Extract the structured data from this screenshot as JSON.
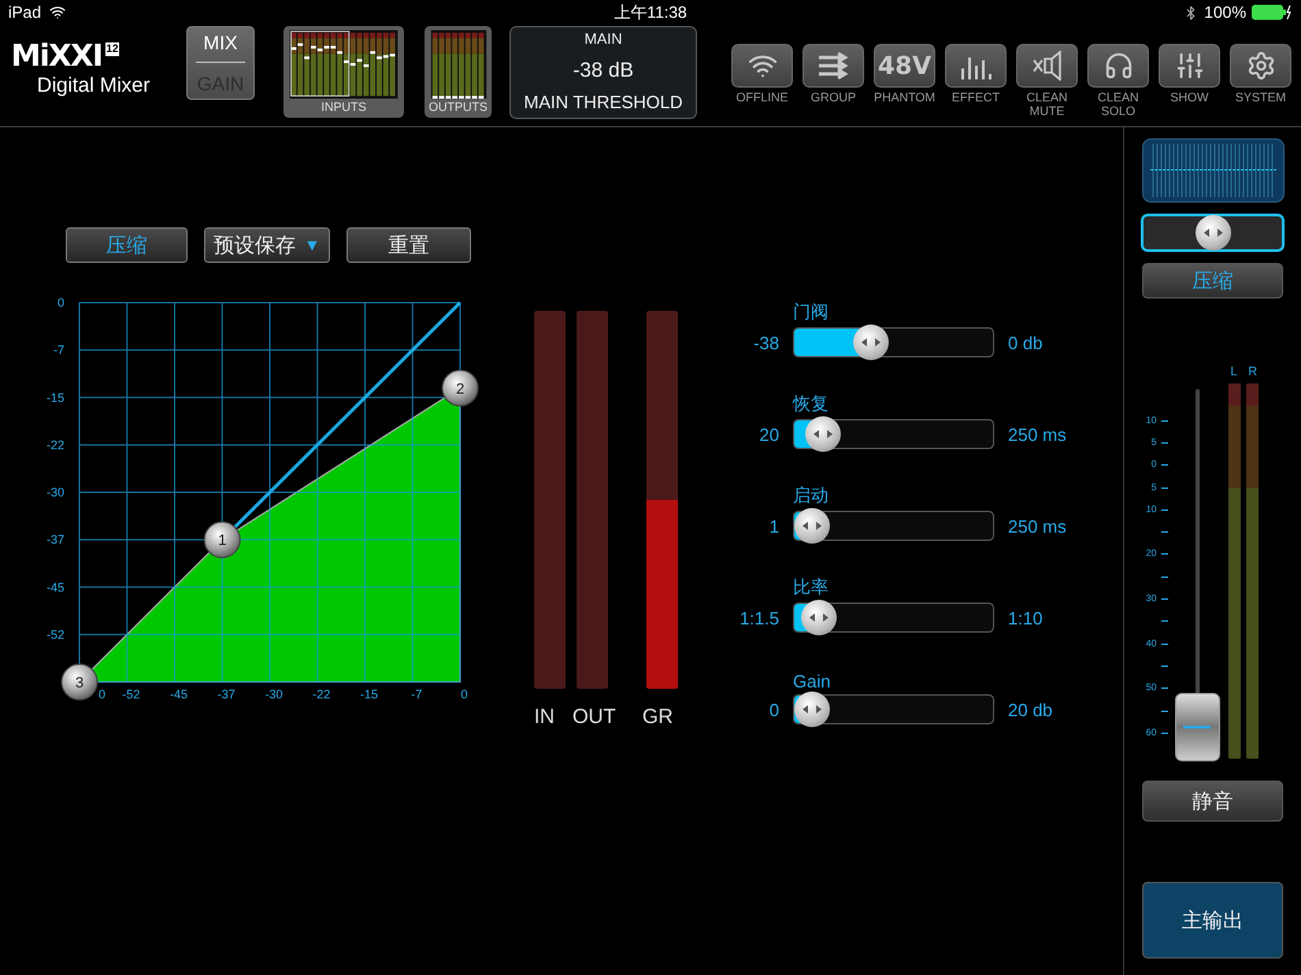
{
  "status_bar": {
    "device": "iPad",
    "time": "上午11:38",
    "battery": "100%"
  },
  "header": {
    "logo": {
      "mark": "MiXXI",
      "badge": "12",
      "subtitle": "Digital Mixer"
    },
    "view_toggle": [
      {
        "label": "MIX",
        "selected": true
      },
      {
        "label": "GAIN",
        "selected": false
      }
    ],
    "thumbnails": [
      {
        "kind": "inputs",
        "label": "INPUTS"
      },
      {
        "kind": "outputs",
        "label": "OUTPUTS"
      }
    ],
    "display": {
      "title": "MAIN",
      "value": "-38 dB",
      "caption": "MAIN THRESHOLD"
    },
    "tools": [
      {
        "kind": "wifi",
        "label": "OFFLINE"
      },
      {
        "kind": "group",
        "label": "GROUP"
      },
      {
        "kind": "phantom",
        "icon_text": "48V",
        "label": "PHANTOM"
      },
      {
        "kind": "effect",
        "label": "EFFECT"
      },
      {
        "kind": "mute",
        "label": "CLEAN MUTE"
      },
      {
        "kind": "solo",
        "label": "CLEAN SOLO"
      },
      {
        "kind": "show",
        "label": "SHOW"
      },
      {
        "kind": "system",
        "label": "SYSTEM"
      }
    ]
  },
  "editor": {
    "actions": [
      {
        "kind": "mode",
        "label": "压缩"
      },
      {
        "kind": "dropdown",
        "label": "预设保存",
        "caret": "▼"
      },
      {
        "kind": "button",
        "label": "重置"
      }
    ],
    "curve_editor": {
      "y_labels": [
        "0",
        "-7",
        "-15",
        "-22",
        "-30",
        "-37",
        "-45",
        "-52"
      ],
      "x_labels": [
        "0",
        "-52",
        "-45",
        "-37",
        "-30",
        "-22",
        "-15",
        "-7",
        "0"
      ],
      "handles": [
        "1",
        "2",
        "3"
      ]
    },
    "meters": [
      {
        "label": "IN",
        "level": 0
      },
      {
        "label": "OUT",
        "level": 0
      },
      {
        "label": "GR",
        "level": 0.5
      }
    ],
    "sliders": [
      {
        "label": "门阀",
        "value": "-38",
        "max": "0 db",
        "level": 0.36
      },
      {
        "label": "恢复",
        "value": "20",
        "max": "250 ms",
        "level": 0.07
      },
      {
        "label": "启动",
        "value": "1",
        "max": "250 ms",
        "level": 0
      },
      {
        "label": "比率",
        "value": "1:1.5",
        "max": "1:10",
        "level": 0.04
      },
      {
        "label": "Gain",
        "value": "0",
        "max": "20 db",
        "level": 0
      }
    ]
  },
  "channel_strip": {
    "mode": "压缩",
    "fader": {
      "scale": [
        "10",
        "5",
        "0",
        "5",
        "10",
        "20",
        "30",
        "40",
        "50",
        "60"
      ],
      "level": 0
    },
    "meters": [
      {
        "label": "L"
      },
      {
        "label": "R"
      }
    ],
    "mute": "静音",
    "output": "主输出"
  }
}
